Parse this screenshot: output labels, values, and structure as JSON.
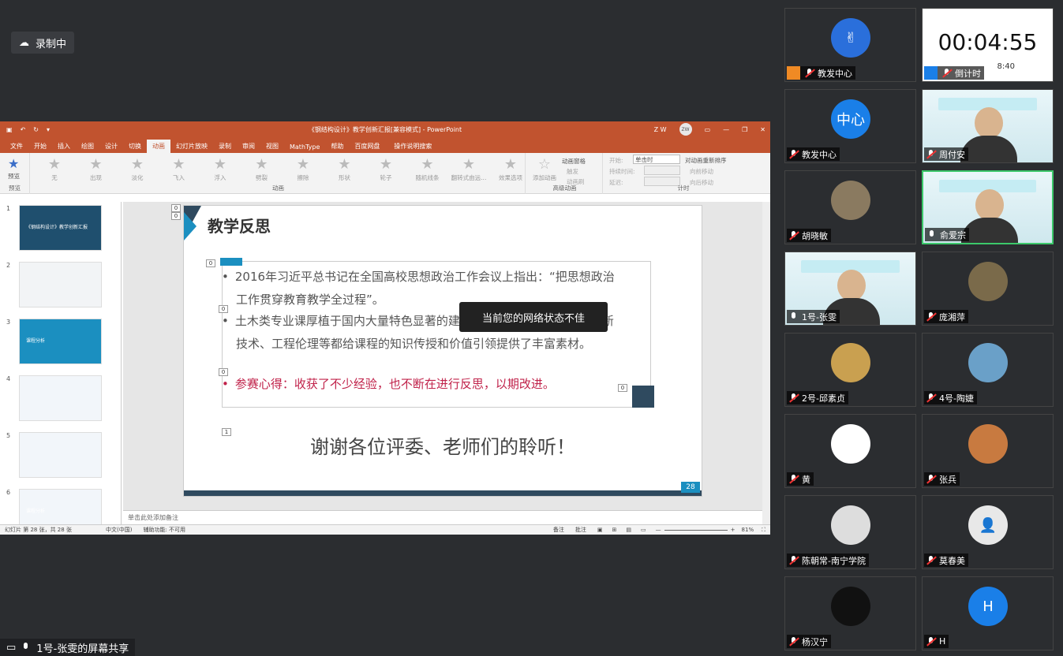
{
  "recording": {
    "label": "录制中"
  },
  "ppt": {
    "doc_title": "《钢结构设计》教学创新汇报[兼容模式] - PowerPoint",
    "user_initials": "ZW",
    "user_badge": "Z W",
    "menu": [
      "文件",
      "开始",
      "插入",
      "绘图",
      "设计",
      "切换",
      "动画",
      "幻灯片放映",
      "录制",
      "审阅",
      "视图",
      "MathType",
      "帮助",
      "百度网盘",
      "操作说明搜索"
    ],
    "active_menu": "动画",
    "ribbon": {
      "preview_label": "预览",
      "preview_group": "预览",
      "effects": [
        "无",
        "出现",
        "淡化",
        "飞入",
        "浮入",
        "劈裂",
        "擦除",
        "形状",
        "轮子",
        "随机线条",
        "翻转式由远..."
      ],
      "effect_options": "效果选项",
      "group_animation": "动画",
      "add_animation": "添加动画",
      "animation_pane": "动画窗格",
      "trigger": "触发",
      "animation_painter": "动画刷",
      "group_advanced": "高级动画",
      "start_label": "开始:",
      "start_value": "单击时",
      "duration_label": "持续时间:",
      "delay_label": "延迟:",
      "reorder": "对动画重新排序",
      "move_earlier": "向前移动",
      "move_later": "向后移动",
      "group_timing": "计时"
    },
    "thumbnails": [
      {
        "num": "1",
        "text": "《钢结构设计》教学创新汇报"
      },
      {
        "num": "2",
        "text": ""
      },
      {
        "num": "3",
        "text": "课程分析"
      },
      {
        "num": "4",
        "text": ""
      },
      {
        "num": "5",
        "text": ""
      },
      {
        "num": "6",
        "text": "课程分析"
      }
    ],
    "slide": {
      "title": "教学反思",
      "bullets": [
        "2016年习近平总书记在全国高校思想政治工作会议上指出：“把思想政治工作贯穿教育教学全过程”。",
        "土木类专业课厚植于国内大量特色显著的建筑工程实践，工程问题、创新技术、工程伦理等都给课程的知识传授和价值引领提供了丰富素材。",
        "参赛心得：收获了不少经验，也不断在进行反思，以期改进。"
      ],
      "thanks": "谢谢各位评委、老师们的聆听！",
      "page_number": "28",
      "anim_tags": [
        "0",
        "0",
        "0",
        "0",
        "0",
        "0",
        "0",
        "1"
      ]
    },
    "notes_placeholder": "单击此处添加备注",
    "status": {
      "slide_count": "幻灯片 第 28 张，共 28 张",
      "language": "中文(中国)",
      "accessibility": "辅助功能: 不可用",
      "notes_btn": "备注",
      "comments_btn": "批注",
      "zoom": "81%"
    }
  },
  "toast": "当前您的网络状态不佳",
  "share_label": "1号-张雯的屏幕共享",
  "participants": [
    {
      "name": "教发中心",
      "avatar": "✌",
      "color": "#2a6fdb",
      "muted": true,
      "host": true
    },
    {
      "name": "倒计时",
      "timer": "00:04:55",
      "sub": "8:40",
      "muted": true,
      "host": true
    },
    {
      "name": "教发中心",
      "avatar": "中心",
      "color": "#1a7fe8",
      "muted": true
    },
    {
      "name": "周付安",
      "video": true,
      "muted": true
    },
    {
      "name": "胡晓敏",
      "avatar": "",
      "color": "#8a7a60",
      "muted": true
    },
    {
      "name": "俞爱宗",
      "video": true,
      "muted": false,
      "active": true
    },
    {
      "name": "1号-张雯",
      "video": true,
      "muted": false
    },
    {
      "name": "庞湘萍",
      "avatar": "",
      "color": "#7a6a4a",
      "muted": true
    },
    {
      "name": "2号-邱素贞",
      "avatar": "",
      "color": "#c9a050",
      "muted": true
    },
    {
      "name": "4号-陶婕",
      "avatar": "",
      "color": "#6aa0c8",
      "muted": true
    },
    {
      "name": "黄",
      "avatar": "",
      "color": "#fff",
      "muted": true
    },
    {
      "name": "张兵",
      "avatar": "",
      "color": "#c87a40",
      "muted": true
    },
    {
      "name": "陈朝常-南宁学院",
      "avatar": "",
      "color": "#ddd",
      "muted": true
    },
    {
      "name": "莫春美",
      "avatar": "👤",
      "color": "#e8e8e8",
      "muted": true
    },
    {
      "name": "杨汉宁",
      "avatar": "",
      "color": "#111",
      "muted": true
    },
    {
      "name": "H",
      "avatar": "H",
      "color": "#1a7fe8",
      "muted": true
    }
  ]
}
